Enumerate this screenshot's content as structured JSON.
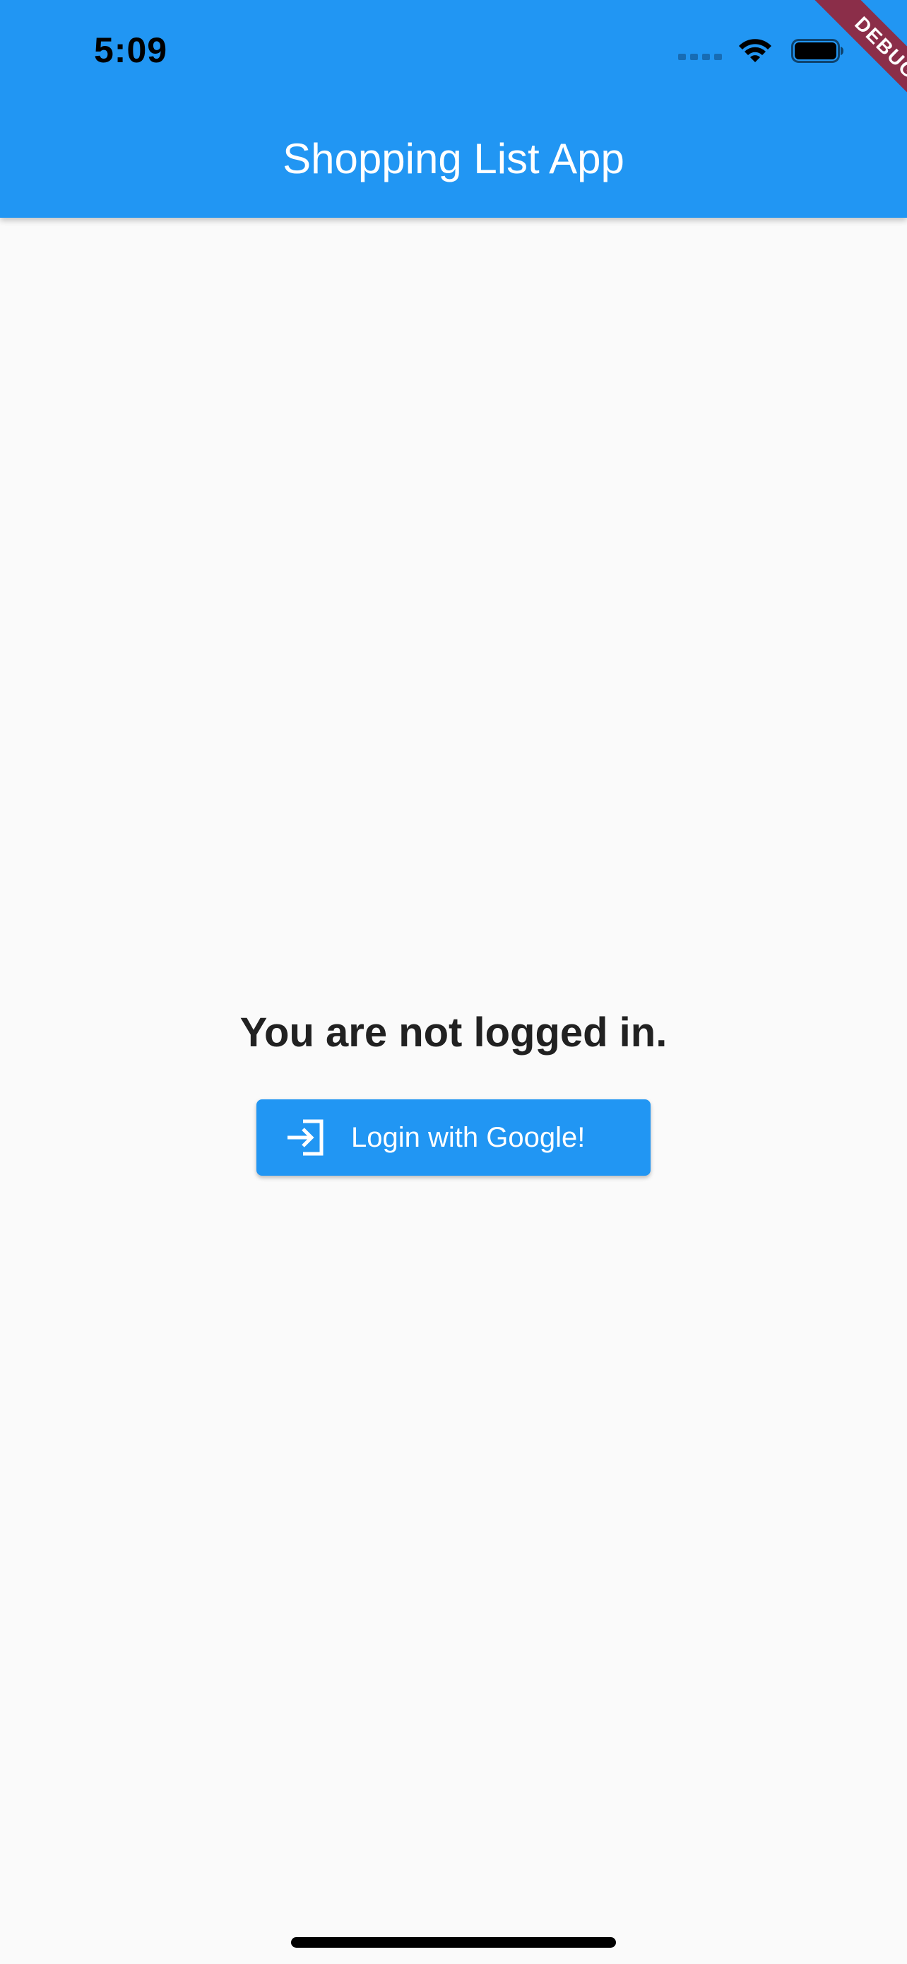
{
  "status_bar": {
    "time": "5:09",
    "icons": [
      "cellular-signal-icon",
      "wifi-icon",
      "battery-icon"
    ]
  },
  "app_bar": {
    "title": "Shopping List App",
    "background_color": "#2196f3"
  },
  "debug_banner": {
    "label": "DEBUG",
    "color": "#8b2e49"
  },
  "main": {
    "message": "You are not logged in.",
    "login_button": {
      "label": "Login with Google!",
      "icon": "login-icon",
      "color": "#2196f3"
    }
  }
}
